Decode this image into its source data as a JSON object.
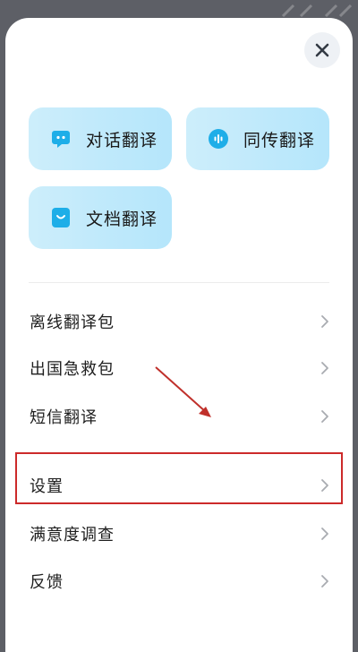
{
  "close": {
    "icon": "close-icon"
  },
  "tiles": [
    {
      "label": "对话翻译",
      "icon": "chat-bubble-icon"
    },
    {
      "label": "同传翻译",
      "icon": "audio-wave-icon"
    },
    {
      "label": "文档翻译",
      "icon": "document-icon"
    }
  ],
  "menu": [
    {
      "label": "离线翻译包"
    },
    {
      "label": "出国急救包"
    },
    {
      "label": "短信翻译"
    },
    {
      "label": "设置"
    },
    {
      "label": "满意度调查"
    },
    {
      "label": "反馈"
    }
  ],
  "colors": {
    "tile_bg": "#c4ebfb",
    "icon_accent": "#1eaee8",
    "annotation": "#cc2a2a"
  }
}
